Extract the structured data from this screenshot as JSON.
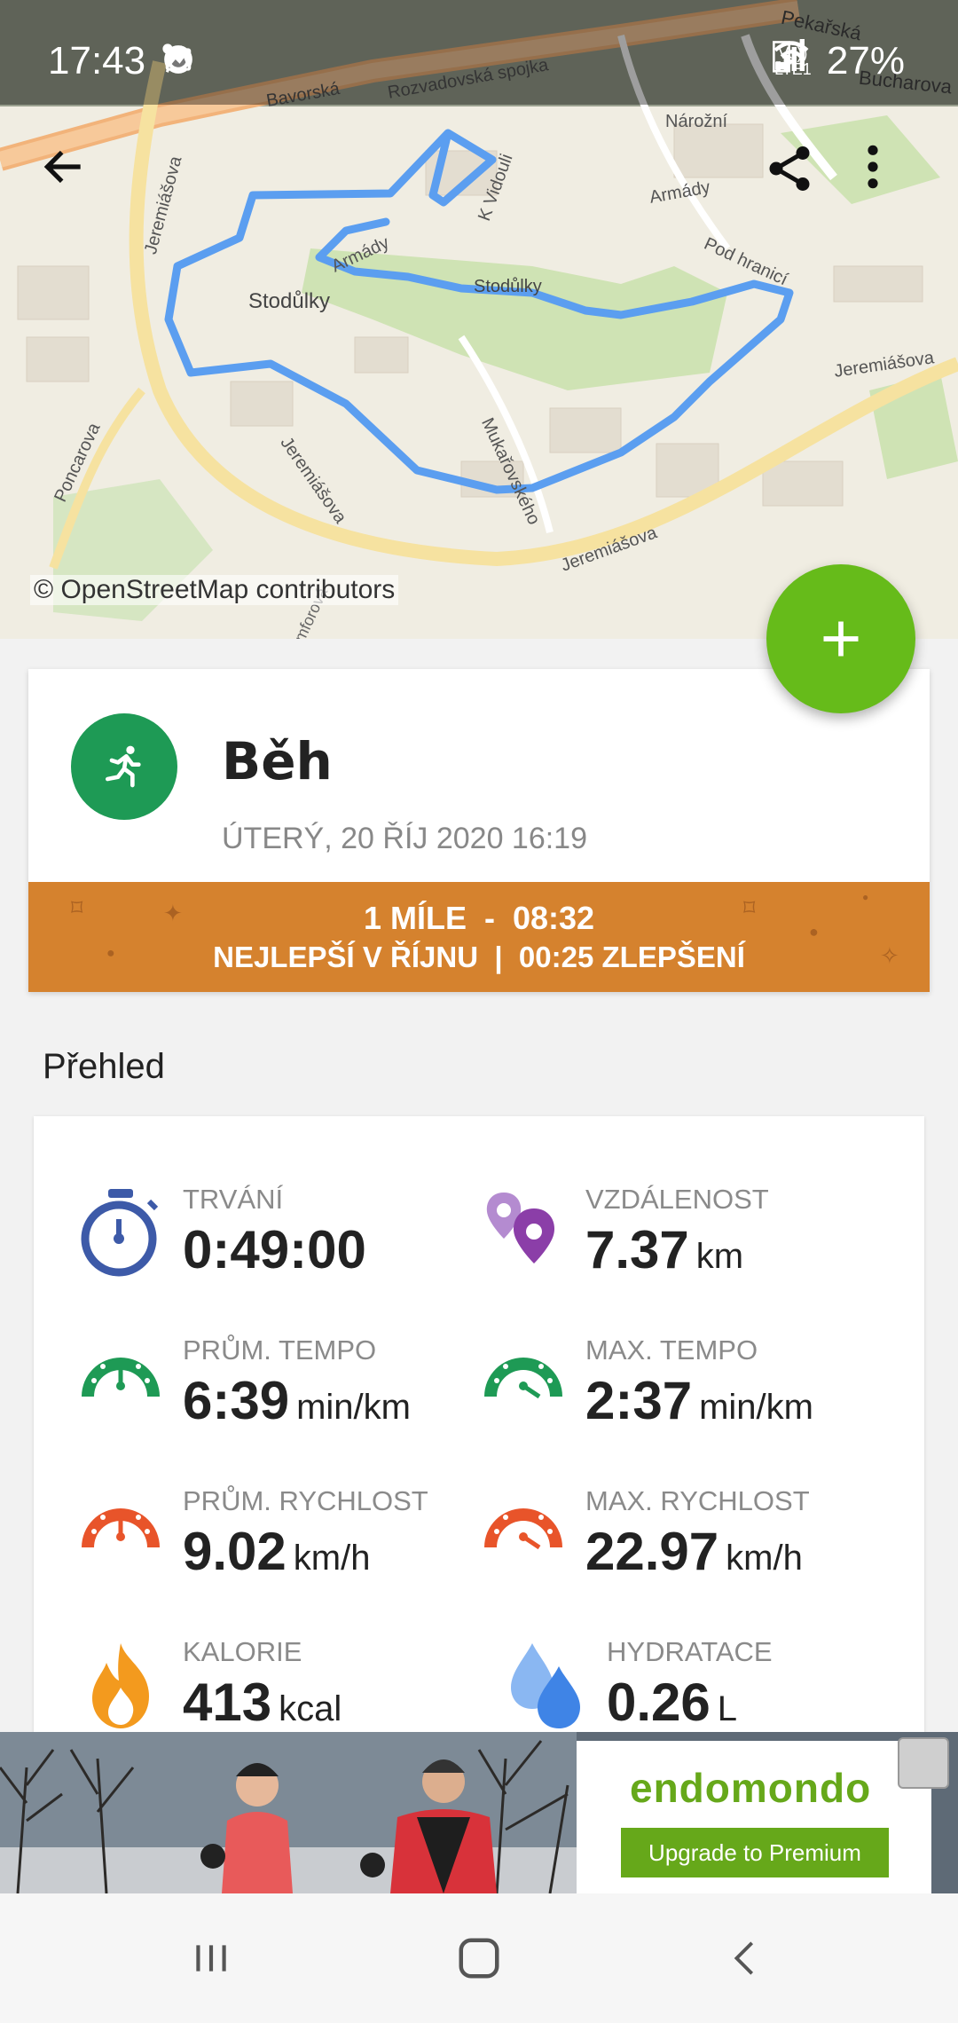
{
  "status_bar": {
    "time": "17:43",
    "network": "Vo)) LTE1",
    "battery": "27%"
  },
  "map": {
    "attribution": "© OpenStreetMap contributors",
    "street_labels": [
      "Bavorská",
      "Rozvadovská spojka",
      "Pekařská",
      "Bucharova",
      "Jeremiášova",
      "Jeremiášova",
      "Jeremiášova",
      "Jeremiášova",
      "Armády",
      "Armády",
      "Stodůlky",
      "Stodůlky",
      "K Vidouli",
      "Nárožní",
      "Pod hranicí",
      "Mukařovského",
      "Poncarova",
      "Amforová"
    ]
  },
  "workout": {
    "sport": "Běh",
    "date": "ÚTERÝ, 20 ŘÍJ 2020 16:19",
    "record_line1": "1 MÍLE  -  08:32",
    "record_line2": "NEJLEPŠÍ V ŘÍJNU  |  00:25 ZLEPŠENÍ"
  },
  "overview": {
    "title": "Přehled",
    "stats": [
      {
        "label": "TRVÁNÍ",
        "value": "0:49:00",
        "unit": "",
        "icon": "stopwatch-icon"
      },
      {
        "label": "VZDÁLENOST",
        "value": "7.37",
        "unit": "km",
        "icon": "map-pin-icon"
      },
      {
        "label": "PRŮM. TEMPO",
        "value": "6:39",
        "unit": "min/km",
        "icon": "avg-pace-gauge-icon"
      },
      {
        "label": "MAX. TEMPO",
        "value": "2:37",
        "unit": "min/km",
        "icon": "max-pace-gauge-icon"
      },
      {
        "label": "PRŮM. RYCHLOST",
        "value": "9.02",
        "unit": "km/h",
        "icon": "avg-speed-gauge-icon"
      },
      {
        "label": "MAX. RYCHLOST",
        "value": "22.97",
        "unit": "km/h",
        "icon": "max-speed-gauge-icon"
      },
      {
        "label": "KALORIE",
        "value": "413",
        "unit": "kcal",
        "icon": "flame-icon"
      },
      {
        "label": "HYDRATACE",
        "value": "0.26",
        "unit": "L",
        "icon": "water-drops-icon"
      }
    ]
  },
  "ad": {
    "brand": "endomondo",
    "button_label": "Upgrade to Premium"
  },
  "colors": {
    "accent_green": "#66bb1a",
    "record_orange": "#d5822e",
    "route_blue": "#5b9ef0",
    "pace_green": "#1e9a55",
    "speed_red": "#e8542a"
  }
}
